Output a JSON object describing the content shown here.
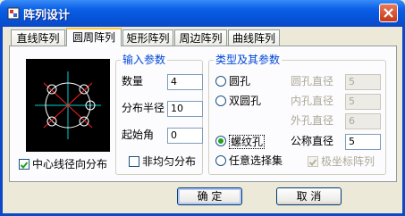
{
  "window": {
    "title": "阵列设计"
  },
  "tabs": [
    {
      "label": "直线阵列",
      "active": false
    },
    {
      "label": "圆周阵列",
      "active": true
    },
    {
      "label": "矩形阵列",
      "active": false
    },
    {
      "label": "周边阵列",
      "active": false
    },
    {
      "label": "曲线阵列",
      "active": false
    }
  ],
  "preview": {
    "checkbox_label": "中心线径向分布",
    "checked": true
  },
  "input_params": {
    "title": "输入参数",
    "count_label": "数量",
    "count_value": "4",
    "radius_label": "分布半径",
    "radius_value": "10",
    "start_angle_label": "起始角",
    "start_angle_value": "0",
    "uneven_label": "非均匀分布",
    "uneven_checked": false
  },
  "type_params": {
    "title": "类型及其参数",
    "options": [
      {
        "label": "圆孔",
        "selected": false
      },
      {
        "label": "双圆孔",
        "selected": false
      },
      {
        "label": "螺纹孔",
        "selected": true
      },
      {
        "label": "任意选择集",
        "selected": false
      }
    ],
    "hole_diameter_label": "圆孔直径",
    "hole_diameter_value": "5",
    "inner_diameter_label": "内孔直径",
    "inner_diameter_value": "5",
    "outer_diameter_label": "外孔直径",
    "outer_diameter_value": "6",
    "nominal_diameter_label": "公称直径",
    "nominal_diameter_value": "5",
    "polar_label": "极坐标阵列",
    "polar_checked": true
  },
  "buttons": {
    "ok": "确 定",
    "cancel": "取 消"
  },
  "colors": {
    "accent": "#0046d5",
    "titlebar": "#0653d8",
    "preview_bg": "#000000"
  }
}
